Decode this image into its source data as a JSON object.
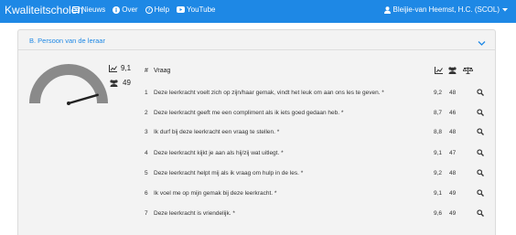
{
  "navbar": {
    "brand": "Kwaliteitscholen",
    "links": [
      {
        "label": "Nieuws",
        "icon": "newspaper-icon"
      },
      {
        "label": "Over",
        "icon": "info-icon"
      },
      {
        "label": "Help",
        "icon": "help-icon"
      },
      {
        "label": "YouTube",
        "icon": "youtube-icon"
      }
    ],
    "user": "Bleijie-van Heemst, H.C. (SCOL)"
  },
  "section": {
    "title": "B. Persoon van de leraar",
    "average": "9,1",
    "respondents": "49",
    "gauge_fraction": 0.91
  },
  "table": {
    "header_num": "#",
    "header_question": "Vraag",
    "rows": [
      {
        "num": "1",
        "question": "Deze leerkracht voelt zich op zijn/haar gemak, vindt het leuk om aan ons les te geven. *",
        "avg": "9,2",
        "count": "48"
      },
      {
        "num": "2",
        "question": "Deze leerkracht geeft me een compliment als ik iets goed gedaan heb. *",
        "avg": "8,7",
        "count": "46"
      },
      {
        "num": "3",
        "question": "Ik durf bij deze leerkracht een vraag te stellen. *",
        "avg": "8,8",
        "count": "48"
      },
      {
        "num": "4",
        "question": "Deze leerkracht kijkt je aan als hij/zij wat uitlegt. *",
        "avg": "9,1",
        "count": "47"
      },
      {
        "num": "5",
        "question": "Deze leerkracht helpt mij als ik vraag om hulp in de les. *",
        "avg": "9,2",
        "count": "48"
      },
      {
        "num": "6",
        "question": "Ik voel me op mijn gemak bij deze leerkracht. *",
        "avg": "9,1",
        "count": "49"
      },
      {
        "num": "7",
        "question": "Deze leerkracht is vriendelijk. *",
        "avg": "9,6",
        "count": "49"
      }
    ]
  },
  "colors": {
    "navbar": "#1e88e5",
    "accent": "#1e88e5",
    "gauge": "#8a8a8a",
    "needle": "#222222"
  }
}
